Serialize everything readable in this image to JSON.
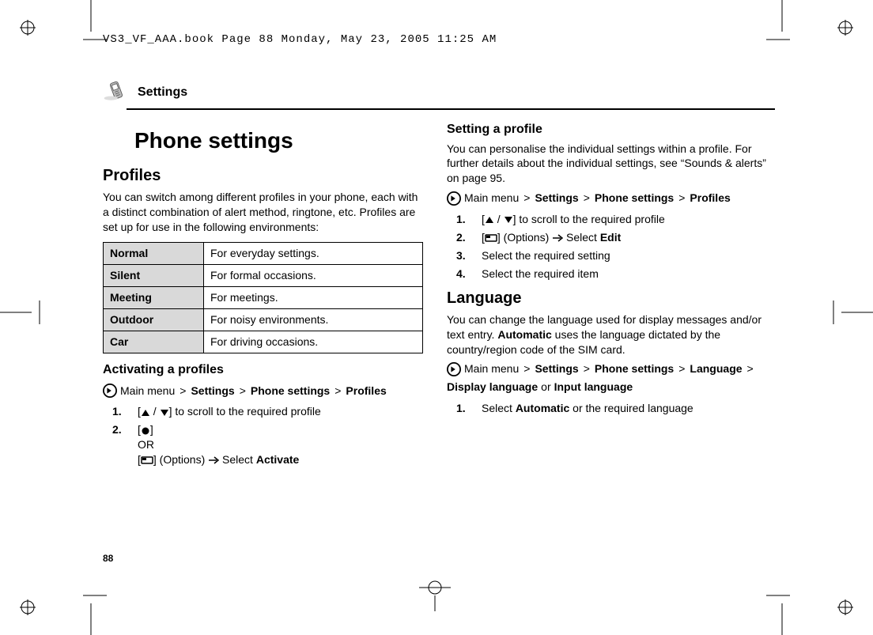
{
  "header": "VS3_VF_AAA.book  Page 88  Monday, May 23, 2005  11:25 AM",
  "section_title": "Settings",
  "page_title": "Phone settings",
  "page_number": "88",
  "left": {
    "profiles_heading": "Profiles",
    "profiles_intro": "You can switch among different profiles in your phone, each with a distinct combination of alert method, ringtone, etc. Profiles are set up for use in the following environments:",
    "table": [
      {
        "name": "Normal",
        "desc": "For everyday settings."
      },
      {
        "name": "Silent",
        "desc": "For formal occasions."
      },
      {
        "name": "Meeting",
        "desc": "For meetings."
      },
      {
        "name": "Outdoor",
        "desc": "For noisy environments."
      },
      {
        "name": "Car",
        "desc": "For driving occasions."
      }
    ],
    "activating_heading": "Activating a profiles",
    "nav_prefix": "Main menu",
    "nav_items": [
      "Settings",
      "Phone settings",
      "Profiles"
    ],
    "step1": " to scroll to the required profile",
    "step2_or": "OR",
    "step2_options": " (Options) ",
    "step2_select": " Select ",
    "step2_activate": "Activate"
  },
  "right": {
    "setting_heading": "Setting a profile",
    "setting_intro": "You can personalise the individual settings within a profile. For further details about the individual settings, see “Sounds & alerts” on page 95.",
    "nav_prefix": "Main menu",
    "nav_items": [
      "Settings",
      "Phone settings",
      "Profiles"
    ],
    "step1": " to scroll to the required profile",
    "step2_options": " (Options) ",
    "step2_select": " Select ",
    "step2_edit": "Edit",
    "step3": "Select the required setting",
    "step4": "Select the required item",
    "language_heading": "Language",
    "language_intro_a": "You can change the language used for display messages and/or text entry. ",
    "language_intro_bold": "Automatic",
    "language_intro_b": " uses the language dictated by the country/region code of the SIM card.",
    "lang_nav_prefix": "Main menu",
    "lang_nav_items": [
      "Settings",
      "Phone settings",
      "Language"
    ],
    "lang_nav_tail_a": "Display language",
    "lang_nav_tail_or": " or ",
    "lang_nav_tail_b": "Input language",
    "lang_step1_a": "Select ",
    "lang_step1_bold": "Automatic",
    "lang_step1_b": " or the required language"
  }
}
